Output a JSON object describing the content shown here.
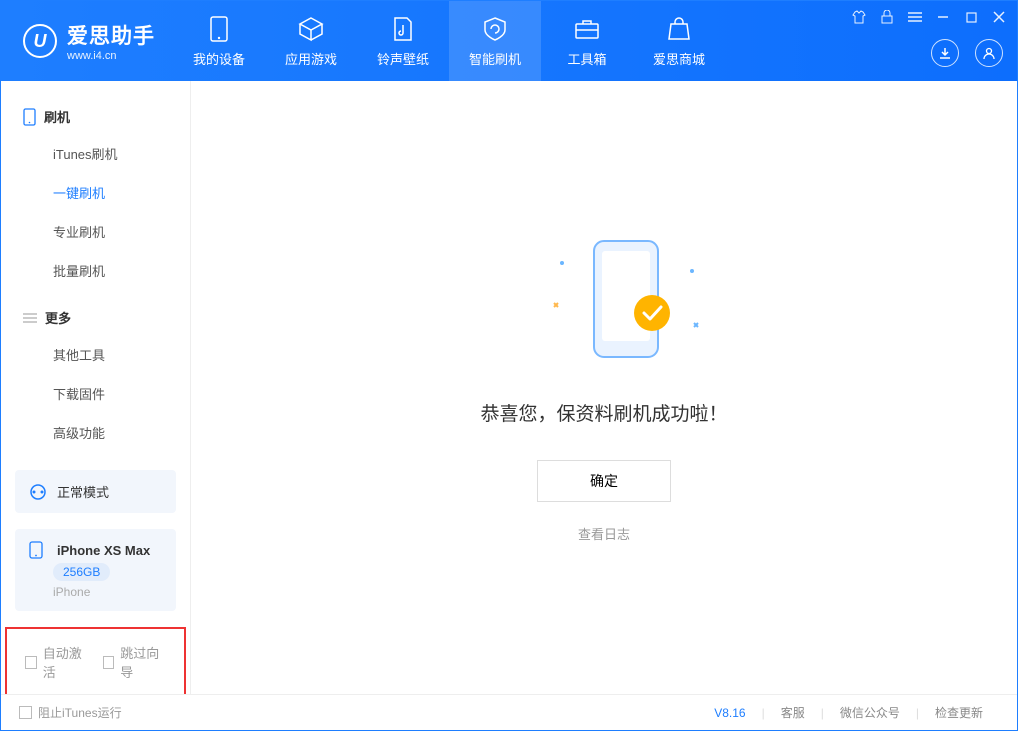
{
  "app": {
    "title": "爱思助手",
    "subtitle": "www.i4.cn"
  },
  "nav": {
    "items": [
      {
        "label": "我的设备"
      },
      {
        "label": "应用游戏"
      },
      {
        "label": "铃声壁纸"
      },
      {
        "label": "智能刷机"
      },
      {
        "label": "工具箱"
      },
      {
        "label": "爱思商城"
      }
    ]
  },
  "sidebar": {
    "section1": {
      "title": "刷机",
      "items": [
        {
          "label": "iTunes刷机"
        },
        {
          "label": "一键刷机"
        },
        {
          "label": "专业刷机"
        },
        {
          "label": "批量刷机"
        }
      ]
    },
    "section2": {
      "title": "更多",
      "items": [
        {
          "label": "其他工具"
        },
        {
          "label": "下载固件"
        },
        {
          "label": "高级功能"
        }
      ]
    },
    "mode_label": "正常模式",
    "device": {
      "name": "iPhone XS Max",
      "capacity": "256GB",
      "type": "iPhone"
    },
    "options": {
      "auto_activate": "自动激活",
      "skip_guide": "跳过向导"
    }
  },
  "main": {
    "status_text": "恭喜您，保资料刷机成功啦！",
    "ok_label": "确定",
    "log_link": "查看日志"
  },
  "footer": {
    "block_itunes": "阻止iTunes运行",
    "version": "V8.16",
    "links": {
      "support": "客服",
      "wechat": "微信公众号",
      "update": "检查更新"
    }
  }
}
